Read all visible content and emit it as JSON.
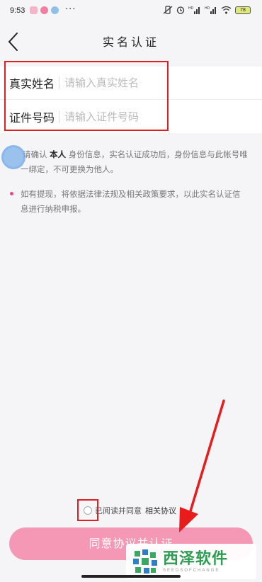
{
  "status_bar": {
    "time": "9:53",
    "battery": "78"
  },
  "header": {
    "title": "实名认证"
  },
  "form": {
    "name_label": "真实姓名",
    "name_placeholder": "请输入真实姓名",
    "id_label": "证件号码",
    "id_placeholder": "请输入证件号码"
  },
  "notices": {
    "n1_pre": "请确认",
    "n1_strong": "本人",
    "n1_post": "身份信息，实名认证成功后，身份信息与此帐号唯",
    "n1_line2": "一绑定，不可更换为他人。",
    "n2_line1": "如有提现，将依据法律法规及相关政策要求，以此实名认证信",
    "n2_line2": "息进行纳税申报。"
  },
  "agreement": {
    "text": "已阅读并同意",
    "link": "相关协议"
  },
  "submit": {
    "label": "同意协议并认证"
  },
  "watermark": {
    "title": "西泽软件",
    "subtitle": "SEEDSOFCHANGE"
  },
  "colors": {
    "accent": "#f598b5",
    "bullet": "#e84a7f",
    "highlight": "#e02020"
  }
}
